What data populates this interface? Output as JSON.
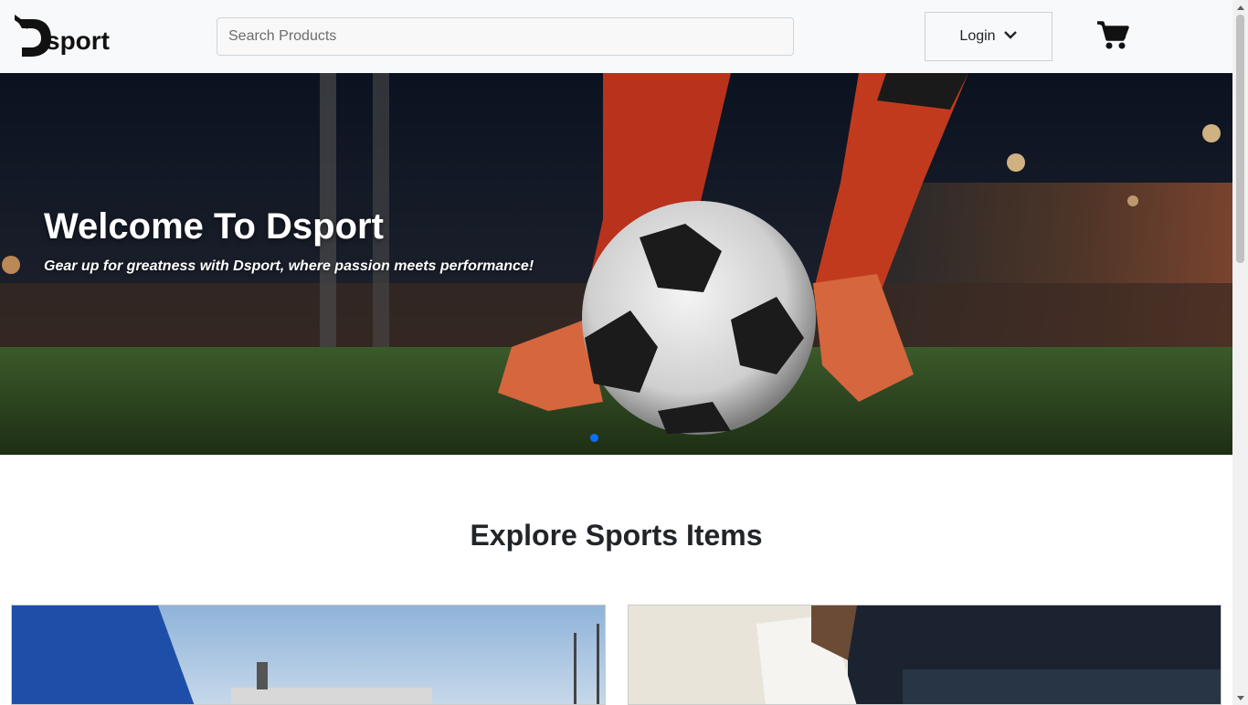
{
  "brand": {
    "logo_text": "Dsport"
  },
  "header": {
    "search_placeholder": "Search Products",
    "login_label": "Login",
    "cart_icon": "cart-icon"
  },
  "hero": {
    "title": "Welcome To Dsport",
    "subtitle": "Gear up for greatness with Dsport, where passion meets performance!",
    "slides_count": 1,
    "active_slide": 1
  },
  "explore": {
    "title": "Explore Sports Items"
  },
  "colors": {
    "header_bg": "#f8f9fa",
    "accent": "#0d6efd",
    "text": "#212529"
  }
}
